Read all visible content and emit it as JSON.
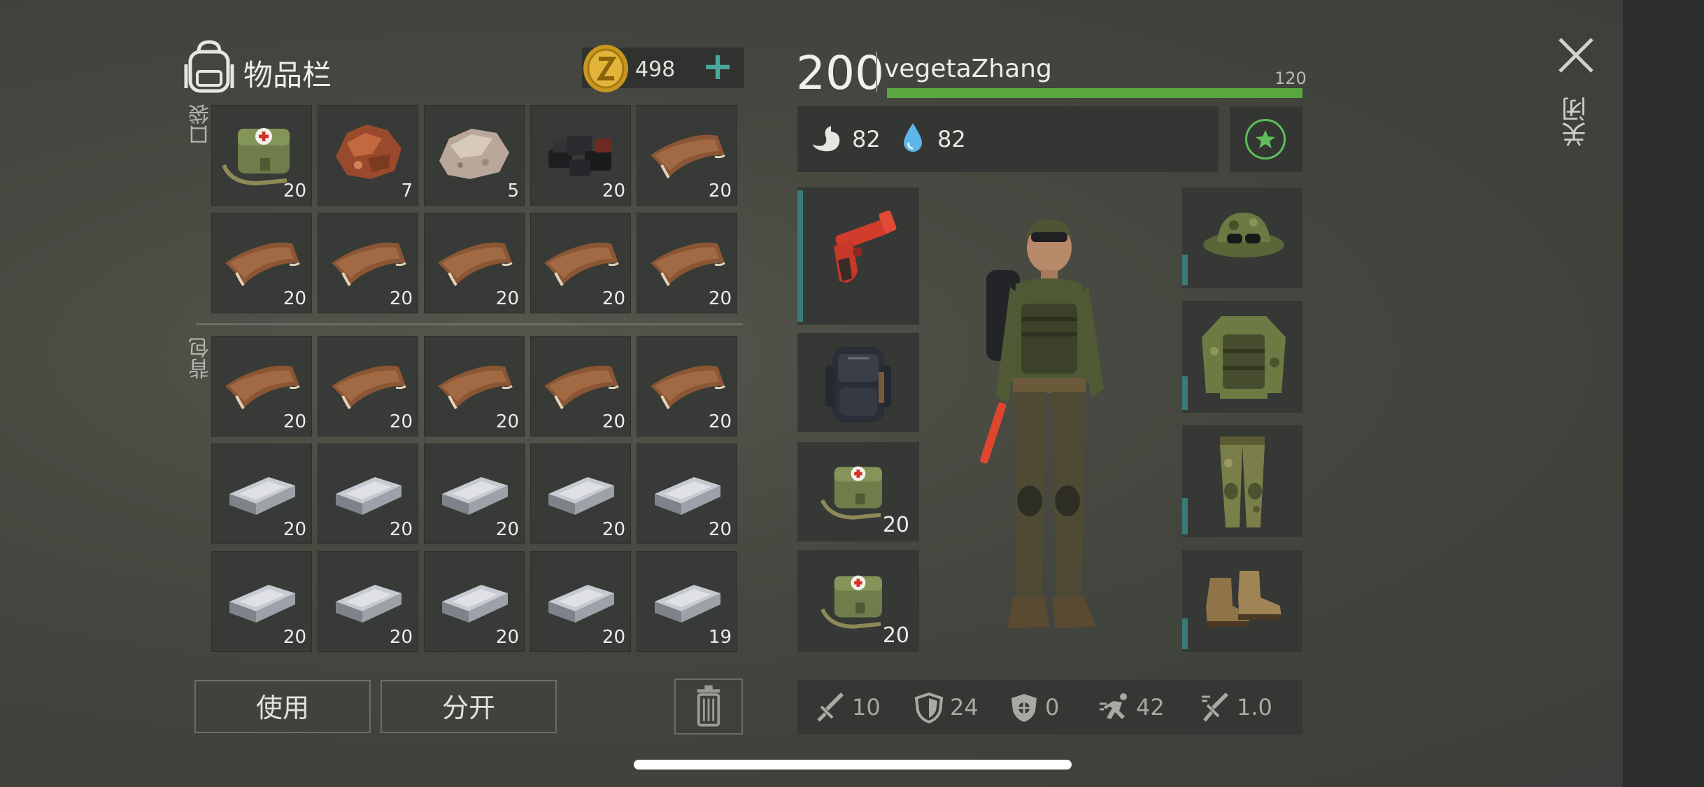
{
  "inventory": {
    "title": "物品栏",
    "coins": "498",
    "add_icon": "plus-icon",
    "pocket_label": "口袋",
    "backpack_label": "背包",
    "pocket_slots": [
      {
        "item": "medkit",
        "count": "20"
      },
      {
        "item": "iron-ore",
        "count": "7"
      },
      {
        "item": "stone",
        "count": "5"
      },
      {
        "item": "coal",
        "count": "20"
      },
      {
        "item": "leather",
        "count": "20"
      },
      {
        "item": "leather",
        "count": "20"
      },
      {
        "item": "leather",
        "count": "20"
      },
      {
        "item": "leather",
        "count": "20"
      },
      {
        "item": "leather",
        "count": "20"
      },
      {
        "item": "leather",
        "count": "20"
      }
    ],
    "backpack_slots": [
      {
        "item": "leather",
        "count": "20"
      },
      {
        "item": "leather",
        "count": "20"
      },
      {
        "item": "leather",
        "count": "20"
      },
      {
        "item": "leather",
        "count": "20"
      },
      {
        "item": "leather",
        "count": "20"
      },
      {
        "item": "iron-bar",
        "count": "20"
      },
      {
        "item": "iron-bar",
        "count": "20"
      },
      {
        "item": "iron-bar",
        "count": "20"
      },
      {
        "item": "iron-bar",
        "count": "20"
      },
      {
        "item": "iron-bar",
        "count": "20"
      },
      {
        "item": "iron-bar",
        "count": "20"
      },
      {
        "item": "iron-bar",
        "count": "20"
      },
      {
        "item": "iron-bar",
        "count": "20"
      },
      {
        "item": "iron-bar",
        "count": "20"
      },
      {
        "item": "iron-bar",
        "count": "19"
      }
    ],
    "use_label": "使用",
    "split_label": "分开"
  },
  "character": {
    "level": "200",
    "name": "vegetaZhang",
    "xp": "120",
    "xp_fraction": 1.0,
    "hunger": "82",
    "thirst": "82",
    "left_equipment": [
      {
        "item": "flare-gun",
        "count": ""
      },
      {
        "item": "backpack",
        "count": ""
      },
      {
        "item": "medkit",
        "count": "20"
      },
      {
        "item": "medkit",
        "count": "20"
      }
    ],
    "right_equipment": [
      {
        "item": "camo-hat-with-goggles"
      },
      {
        "item": "camo-jacket"
      },
      {
        "item": "camo-pants"
      },
      {
        "item": "boots"
      }
    ],
    "stats": {
      "attack": "10",
      "defense": "24",
      "armor": "0",
      "speed": "42",
      "attack_speed": "1.0"
    }
  },
  "close_label": "关闭",
  "colors": {
    "xp_bar": "#59a83f",
    "accent": "#4aa89a",
    "slot_bg": "#373a36",
    "star": "#5cbf5a"
  }
}
